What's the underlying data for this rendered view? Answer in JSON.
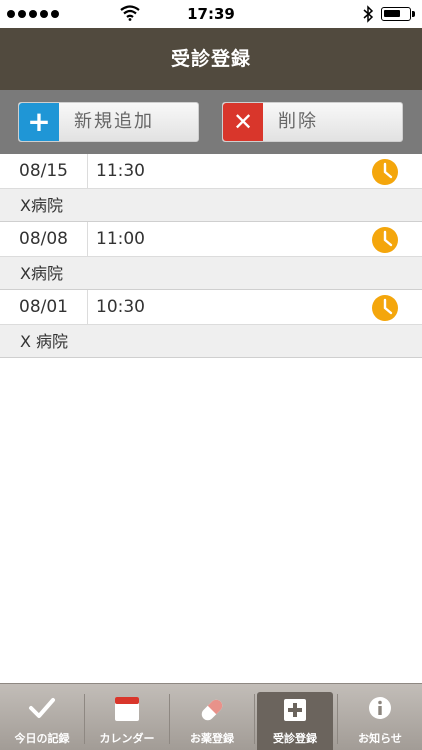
{
  "status_bar": {
    "time": "17:39"
  },
  "nav": {
    "title": "受診登録"
  },
  "toolbar": {
    "add_label": "新規追加",
    "delete_label": "削除"
  },
  "entries": [
    {
      "date": "08/15",
      "time": "11:30",
      "hospital": "X病院"
    },
    {
      "date": "08/08",
      "time": "11:00",
      "hospital": "X病院"
    },
    {
      "date": "08/01",
      "time": "10:30",
      "hospital": "X 病院"
    }
  ],
  "tabs": [
    {
      "label": "今日の記録",
      "icon": "check-icon"
    },
    {
      "label": "カレンダー",
      "icon": "calendar-icon"
    },
    {
      "label": "お薬登録",
      "icon": "pill-icon"
    },
    {
      "label": "受診登録",
      "icon": "medical-cross-icon",
      "selected": true
    },
    {
      "label": "お知らせ",
      "icon": "info-icon"
    }
  ],
  "colors": {
    "nav_bg": "#514a3e",
    "add_blue": "#1f96d6",
    "delete_red": "#d9362b",
    "clock_orange": "#f4a60c"
  }
}
